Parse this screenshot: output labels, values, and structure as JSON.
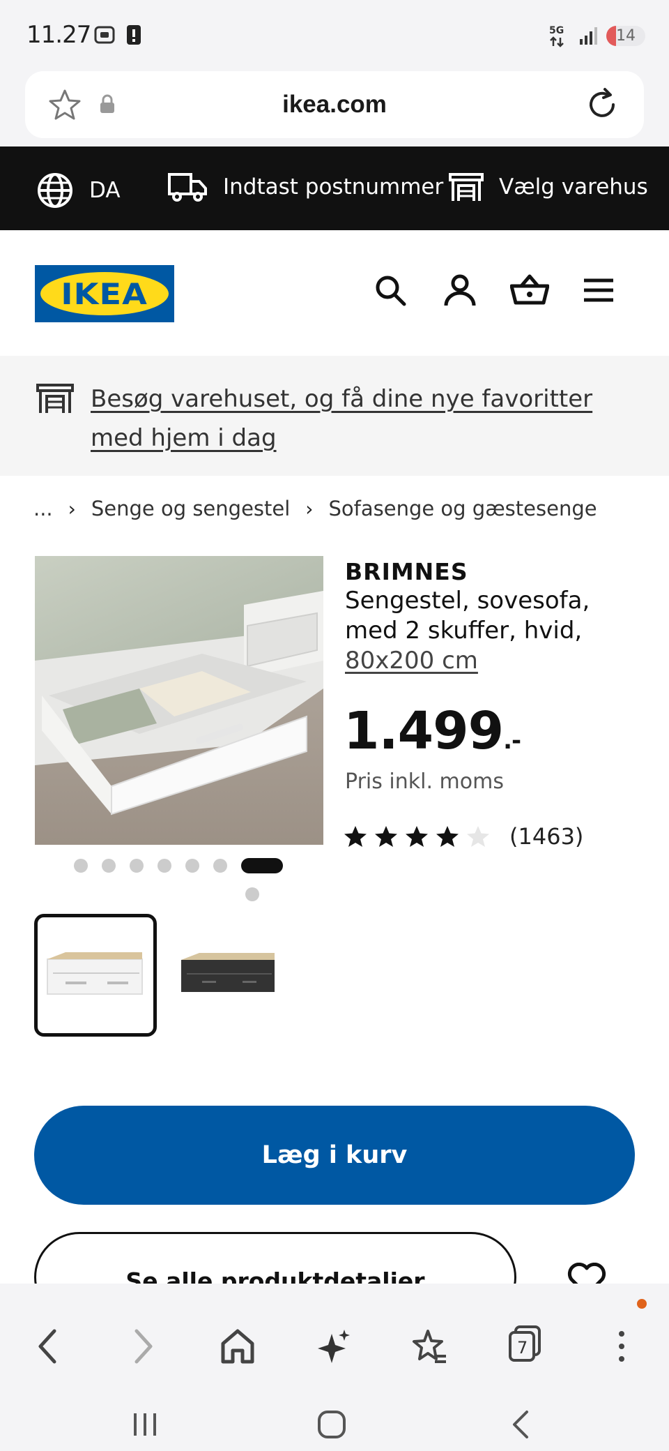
{
  "status_bar": {
    "time": "11.27",
    "battery": "14"
  },
  "browser": {
    "url": "ikea.com",
    "tab_count": "7"
  },
  "utility_nav": {
    "language": "DA",
    "postcode": "Indtast postnummer",
    "store": "Vælg varehus"
  },
  "brand": {
    "logo_text": "IKEA",
    "blue": "#0058a3",
    "yellow": "#ffda1a"
  },
  "store_banner": {
    "text": "Besøg varehuset, og få dine nye favoritter med hjem i dag"
  },
  "breadcrumb": {
    "ellipsis": "...",
    "items": [
      "Senge og sengestel",
      "Sofasenge og gæstesenge"
    ]
  },
  "product": {
    "name": "BRIMNES",
    "description": "Sengestel, sovesofa, med 2 skuffer, hvid,",
    "size": "80x200 cm",
    "price": "1.499",
    "price_suffix": ".-",
    "vat_note": "Pris inkl. moms",
    "rating": 4,
    "rating_max": 5,
    "review_count": "(1463)"
  },
  "carousel": {
    "total": 8,
    "active_index": 6
  },
  "buttons": {
    "add_to_cart": "Læg i kurv",
    "all_details": "Se alle produktdetaljer"
  }
}
